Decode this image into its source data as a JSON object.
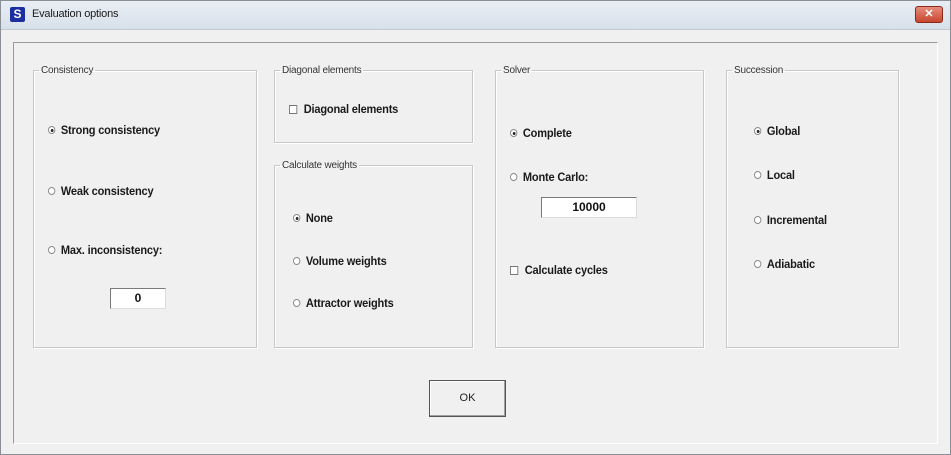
{
  "window": {
    "title": "Evaluation options",
    "icon_letter": "S",
    "close_glyph": "✕"
  },
  "consistency": {
    "legend": "Consistency",
    "strong": "Strong consistency",
    "weak": "Weak consistency",
    "max": "Max. inconsistency:",
    "max_value": "0",
    "selected": "strong"
  },
  "diagonal": {
    "legend": "Diagonal elements",
    "checkbox_label": "Diagonal elements",
    "checked": false
  },
  "weights": {
    "legend": "Calculate weights",
    "none": "None",
    "volume": "Volume weights",
    "attractor": "Attractor weights",
    "selected": "none"
  },
  "solver": {
    "legend": "Solver",
    "complete": "Complete",
    "monte_carlo": "Monte Carlo:",
    "monte_carlo_value": "10000",
    "cycles": "Calculate cycles",
    "cycles_checked": false,
    "selected": "complete"
  },
  "succession": {
    "legend": "Succession",
    "global": "Global",
    "local": "Local",
    "incremental": "Incremental",
    "adiabatic": "Adiabatic",
    "selected": "global"
  },
  "ok_label": "OK"
}
